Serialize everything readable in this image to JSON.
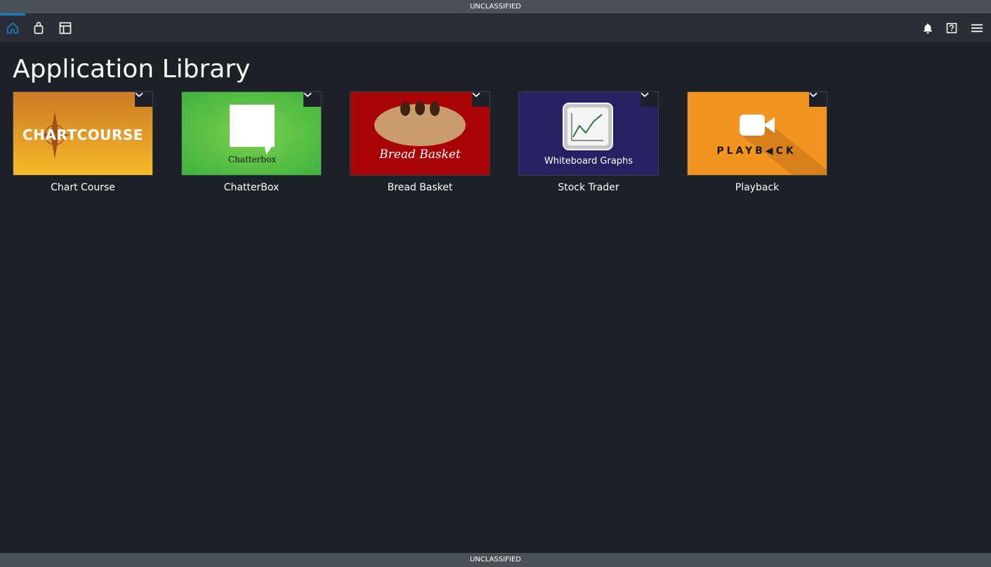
{
  "classification": "UNCLASSIFIED",
  "title": "Application Library",
  "apps": [
    {
      "name": "Chart Course",
      "logo_text": "CHARTCOURSE"
    },
    {
      "name": "ChatterBox",
      "logo_text": "Chatterbox"
    },
    {
      "name": "Bread Basket",
      "logo_text": "Bread Basket"
    },
    {
      "name": "Stock Trader",
      "logo_text": "Whiteboard Graphs"
    },
    {
      "name": "Playback",
      "logo_text": "PLAYB◀CK"
    }
  ],
  "icons": {
    "toolbar_left": [
      "home-icon",
      "bag-icon",
      "layout-icon"
    ],
    "toolbar_right": [
      "bell-icon",
      "help-icon",
      "menu-icon"
    ],
    "tile_menu": "chevron-down-icon"
  },
  "colors": {
    "banner": "#4a5157",
    "toolbar": "#2a2f35",
    "background": "#1c2027",
    "accent": "#1b7fc4"
  }
}
